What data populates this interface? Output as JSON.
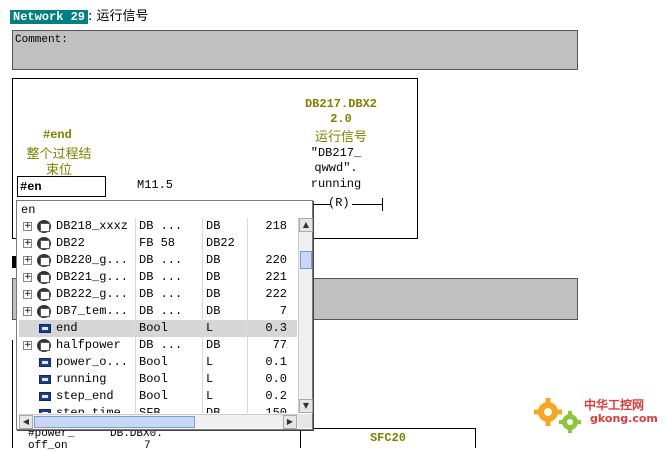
{
  "network": {
    "badge": "Network 29",
    "description": ": 运行信号"
  },
  "comment": {
    "label": "Comment:"
  },
  "ladder": {
    "contact_symbol": "#end",
    "contact_comment_l1": "整个过程结",
    "contact_comment_l2": "束位",
    "contact_operand": "#en",
    "contact_address": "M11.5",
    "coil_addr_l1": "DB217.DBX2",
    "coil_addr_l2": "2.0",
    "coil_comment": "运行信号",
    "coil_sym_l1": "\"DB217_",
    "coil_sym_l2": "qwwd\".",
    "coil_sym_l3": "running",
    "coil_type": "R"
  },
  "bottom": {
    "frag1": "#power_",
    "frag2": "DB.DBX0.",
    "frag3": "off_on",
    "frag4": "7",
    "sfc_title": "SFC20"
  },
  "popup": {
    "input_value": "en",
    "rows": [
      {
        "icon": "db",
        "expand": true,
        "name": "DB218_xxxz",
        "type": "DB  ...",
        "mem": "DB",
        "addr": "218",
        "selected": false
      },
      {
        "icon": "db",
        "expand": true,
        "name": "DB22",
        "type": "FB 58",
        "mem": "DB22",
        "addr": "",
        "selected": false
      },
      {
        "icon": "db",
        "expand": true,
        "name": "DB220_g...",
        "type": "DB  ...",
        "mem": "DB",
        "addr": "220",
        "selected": false
      },
      {
        "icon": "db",
        "expand": true,
        "name": "DB221_g...",
        "type": "DB  ...",
        "mem": "DB",
        "addr": "221",
        "selected": false
      },
      {
        "icon": "db",
        "expand": true,
        "name": "DB222_g...",
        "type": "DB  ...",
        "mem": "DB",
        "addr": "222",
        "selected": false
      },
      {
        "icon": "db",
        "expand": true,
        "name": "DB7_tem...",
        "type": "DB  ...",
        "mem": "DB",
        "addr": "7",
        "selected": false
      },
      {
        "icon": "var",
        "expand": false,
        "name": "end",
        "type": "Bool",
        "mem": "L",
        "addr": "0.3",
        "selected": true
      },
      {
        "icon": "db",
        "expand": true,
        "name": "halfpower",
        "type": "DB  ...",
        "mem": "DB",
        "addr": "77",
        "selected": false
      },
      {
        "icon": "var",
        "expand": false,
        "name": "power_o...",
        "type": "Bool",
        "mem": "L",
        "addr": "0.1",
        "selected": false
      },
      {
        "icon": "var",
        "expand": false,
        "name": "running",
        "type": "Bool",
        "mem": "L",
        "addr": "0.0",
        "selected": false
      },
      {
        "icon": "var",
        "expand": false,
        "name": "step_end",
        "type": "Bool",
        "mem": "L",
        "addr": "0.2",
        "selected": false
      },
      {
        "icon": "var",
        "expand": false,
        "name": "step_time",
        "type": "SFB",
        "mem": "DB",
        "addr": "150",
        "selected": false
      }
    ]
  },
  "watermark": {
    "text": "中华工控网",
    "url": "gkong.com"
  },
  "colors": {
    "teal": "#008080",
    "olive": "#808000",
    "gray": "#c0c0c0",
    "selection": "#d6d6d6"
  }
}
